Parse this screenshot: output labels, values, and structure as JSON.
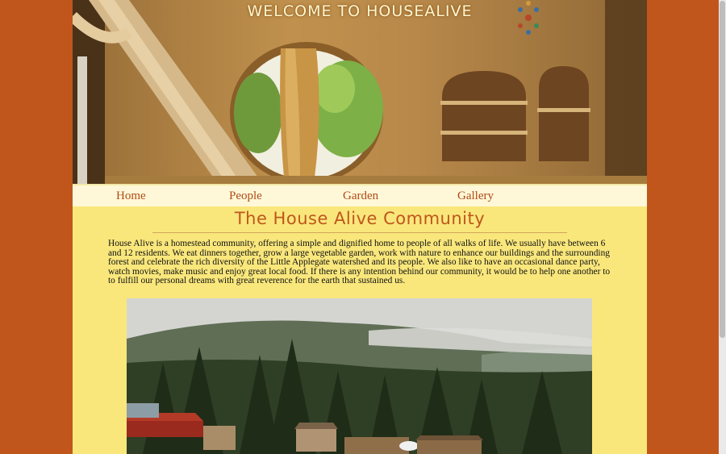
{
  "site": {
    "banner_title": "WELCOME TO HOUSEALIVE"
  },
  "nav": {
    "items": [
      {
        "label": "Home"
      },
      {
        "label": "People"
      },
      {
        "label": "Garden"
      },
      {
        "label": "Gallery"
      }
    ]
  },
  "main": {
    "heading": "The House Alive Community",
    "intro": "House Alive is a homestead community, offering a simple and dignified home to people of all walks of life. We usually have between 6 and 12 residents. We eat dinners together, grow a large vegetable garden, work with nature to enhance our buildings and the surrounding forest and celebrate the rich diversity of the Little Applegate watershed and its people. We also like to have an occasional dance party, watch movies, make music and enjoy great local food. If there is any intention behind our community, it would be to help one another to to fulfill our personal dreams with great reverence for the earth that sustained us."
  },
  "colors": {
    "outer_background": "#c0561c",
    "page_background": "#f9e77c",
    "nav_background": "#fff8d8",
    "accent": "#c0561c"
  }
}
